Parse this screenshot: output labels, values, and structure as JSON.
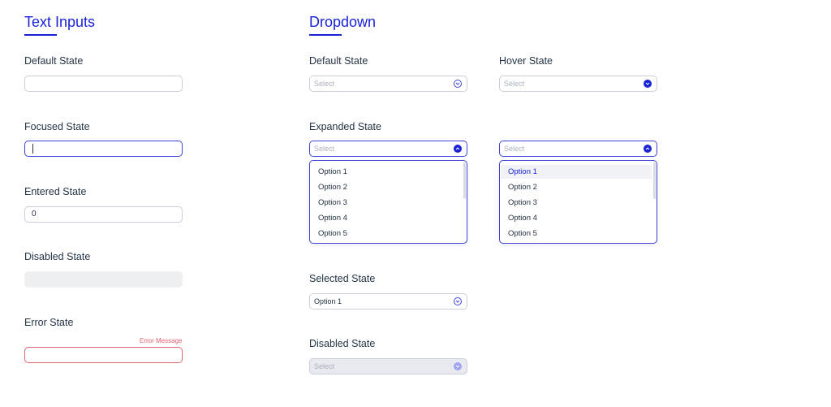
{
  "text_inputs": {
    "title": "Text Inputs",
    "default": {
      "label": "Default State",
      "value": ""
    },
    "focused": {
      "label": "Focused State",
      "value": ""
    },
    "entered": {
      "label": "Entered State",
      "value": "0"
    },
    "disabled": {
      "label": "Disabled State",
      "value": ""
    },
    "error": {
      "label": "Error State",
      "value": "",
      "message": "Error Message"
    }
  },
  "dropdown": {
    "title": "Dropdown",
    "default": {
      "label": "Default State",
      "placeholder": "Select"
    },
    "hover": {
      "label": "Hover State",
      "placeholder": "Select"
    },
    "expanded": {
      "label": "Expanded State",
      "placeholder": "Select",
      "options": [
        "Option 1",
        "Option 2",
        "Option 3",
        "Option 4",
        "Option 5"
      ]
    },
    "expanded_hover": {
      "placeholder": "Select",
      "options": [
        "Option 1",
        "Option 2",
        "Option 3",
        "Option 4",
        "Option 5"
      ],
      "hovered_option": "Option 1"
    },
    "selected": {
      "label": "Selected State",
      "value": "Option 1"
    },
    "disabled": {
      "label": "Disabled State",
      "placeholder": "Select"
    }
  },
  "colors": {
    "accent": "#1a22d6",
    "border": "#c9ced8",
    "focus_border": "#3d44d8",
    "error": "#e2636d",
    "disabled_bg": "#eef0f4"
  },
  "icons": {
    "chevron_down": "chevron-down-icon",
    "chevron_up": "chevron-up-icon"
  }
}
